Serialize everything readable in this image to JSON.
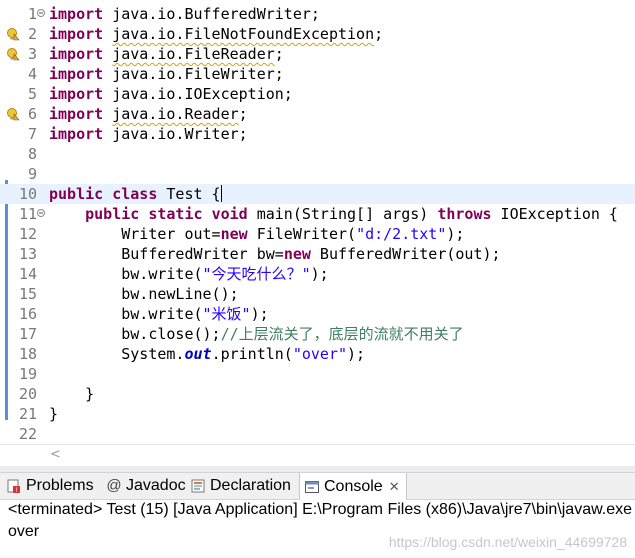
{
  "editor": {
    "lines": [
      {
        "num": "1",
        "fold": true,
        "warn": false,
        "tokens": [
          {
            "t": "import",
            "c": "kw"
          },
          {
            "t": " java.io.BufferedWriter;"
          }
        ]
      },
      {
        "num": "2",
        "fold": false,
        "warn": true,
        "tokens": [
          {
            "t": "import",
            "c": "kw"
          },
          {
            "t": " "
          },
          {
            "t": "java.io.FileNotFoundException",
            "c": "sq"
          },
          {
            "t": ";"
          }
        ]
      },
      {
        "num": "3",
        "fold": false,
        "warn": true,
        "tokens": [
          {
            "t": "import",
            "c": "kw"
          },
          {
            "t": " "
          },
          {
            "t": "java.io.FileReader",
            "c": "sq"
          },
          {
            "t": ";"
          }
        ]
      },
      {
        "num": "4",
        "fold": false,
        "warn": false,
        "tokens": [
          {
            "t": "import",
            "c": "kw"
          },
          {
            "t": " java.io.FileWriter;"
          }
        ]
      },
      {
        "num": "5",
        "fold": false,
        "warn": false,
        "tokens": [
          {
            "t": "import",
            "c": "kw"
          },
          {
            "t": " java.io.IOException;"
          }
        ]
      },
      {
        "num": "6",
        "fold": false,
        "warn": true,
        "tokens": [
          {
            "t": "import",
            "c": "kw"
          },
          {
            "t": " "
          },
          {
            "t": "java.io.Reader",
            "c": "sq"
          },
          {
            "t": ";"
          }
        ]
      },
      {
        "num": "7",
        "fold": false,
        "warn": false,
        "tokens": [
          {
            "t": "import",
            "c": "kw"
          },
          {
            "t": " java.io.Writer;"
          }
        ]
      },
      {
        "num": "8",
        "fold": false,
        "warn": false,
        "tokens": []
      },
      {
        "num": "9",
        "fold": false,
        "warn": false,
        "tokens": []
      },
      {
        "num": "10",
        "fold": false,
        "warn": false,
        "current": true,
        "caret": true,
        "tokens": [
          {
            "t": "public",
            "c": "kw"
          },
          {
            "t": " "
          },
          {
            "t": "class",
            "c": "kw"
          },
          {
            "t": " Test {"
          }
        ]
      },
      {
        "num": "11",
        "fold": true,
        "warn": false,
        "tokens": [
          {
            "t": "    "
          },
          {
            "t": "public",
            "c": "kw"
          },
          {
            "t": " "
          },
          {
            "t": "static",
            "c": "kw"
          },
          {
            "t": " "
          },
          {
            "t": "void",
            "c": "kw"
          },
          {
            "t": " main(String[] args) "
          },
          {
            "t": "throws",
            "c": "kw"
          },
          {
            "t": " IOException {"
          }
        ]
      },
      {
        "num": "12",
        "fold": false,
        "warn": false,
        "tokens": [
          {
            "t": "        Writer out="
          },
          {
            "t": "new",
            "c": "kw"
          },
          {
            "t": " FileWriter("
          },
          {
            "t": "\"d:/2.txt\"",
            "c": "str"
          },
          {
            "t": ");"
          }
        ]
      },
      {
        "num": "13",
        "fold": false,
        "warn": false,
        "tokens": [
          {
            "t": "        BufferedWriter bw="
          },
          {
            "t": "new",
            "c": "kw"
          },
          {
            "t": " BufferedWriter(out);"
          }
        ]
      },
      {
        "num": "14",
        "fold": false,
        "warn": false,
        "tokens": [
          {
            "t": "        bw.write("
          },
          {
            "t": "\"今天吃什么？\"",
            "c": "str"
          },
          {
            "t": ");"
          }
        ]
      },
      {
        "num": "15",
        "fold": false,
        "warn": false,
        "tokens": [
          {
            "t": "        bw.newLine();"
          }
        ]
      },
      {
        "num": "16",
        "fold": false,
        "warn": false,
        "tokens": [
          {
            "t": "        bw.write("
          },
          {
            "t": "\"米饭\"",
            "c": "str"
          },
          {
            "t": ");"
          }
        ]
      },
      {
        "num": "17",
        "fold": false,
        "warn": false,
        "tokens": [
          {
            "t": "        bw.close();"
          },
          {
            "t": "//上层流关了，底层的流就不用关了",
            "c": "cmt"
          }
        ]
      },
      {
        "num": "18",
        "fold": false,
        "warn": false,
        "tokens": [
          {
            "t": "        System."
          },
          {
            "t": "out",
            "c": "fld"
          },
          {
            "t": ".println("
          },
          {
            "t": "\"over\"",
            "c": "str"
          },
          {
            "t": ");"
          }
        ]
      },
      {
        "num": "19",
        "fold": false,
        "warn": false,
        "tokens": []
      },
      {
        "num": "20",
        "fold": false,
        "warn": false,
        "tokens": [
          {
            "t": "    }"
          }
        ]
      },
      {
        "num": "21",
        "fold": false,
        "warn": false,
        "tokens": [
          {
            "t": "}"
          }
        ]
      },
      {
        "num": "22",
        "fold": false,
        "warn": false,
        "tokens": []
      }
    ]
  },
  "scroll_left_glyph": "<",
  "tabs": [
    {
      "label": "Problems",
      "icon": "problems-icon",
      "active": false
    },
    {
      "label": "Javadoc",
      "icon": "javadoc-icon",
      "active": false
    },
    {
      "label": "Declaration",
      "icon": "declaration-icon",
      "active": false
    },
    {
      "label": "Console",
      "icon": "console-icon",
      "active": true,
      "close": "✕"
    }
  ],
  "console": {
    "status": "<terminated> Test (15) [Java Application] E:\\Program Files (x86)\\Java\\jre7\\bin\\javaw.exe",
    "output": "over"
  },
  "watermark": "https://blog.csdn.net/weixin_44699728",
  "colors": {
    "keyword": "#7f0055",
    "string": "#2a00ff",
    "comment": "#3f7f5f",
    "current_line": "#e8f2fe"
  }
}
